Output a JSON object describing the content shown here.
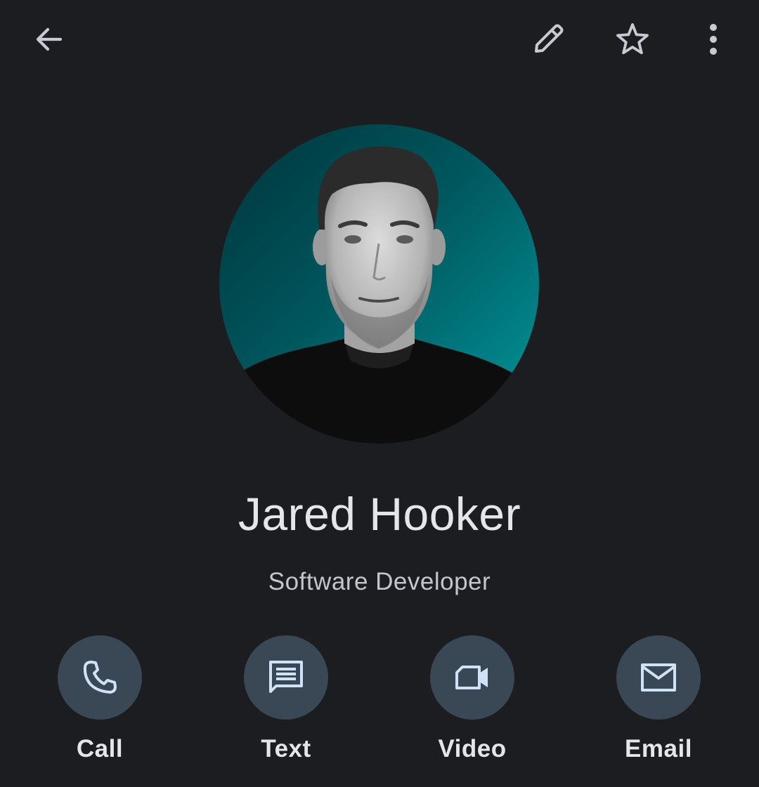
{
  "top_bar": {
    "back_icon": "arrow-left-icon",
    "edit_icon": "pencil-icon",
    "favorite_icon": "star-outline-icon",
    "more_icon": "more-vert-icon",
    "icon_color": "#c7cad1"
  },
  "contact": {
    "name": "Jared Hooker",
    "title": "Software Developer",
    "photo_background": [
      "#004a52",
      "#008c8f"
    ]
  },
  "actions": [
    {
      "label": "Call",
      "icon": "phone-icon"
    },
    {
      "label": "Text",
      "icon": "message-icon"
    },
    {
      "label": "Video",
      "icon": "videocam-icon"
    },
    {
      "label": "Email",
      "icon": "mail-icon"
    }
  ],
  "colors": {
    "background": "#1b1d21",
    "action_circle": "#3a4855",
    "action_icon": "#cfe2f7"
  }
}
